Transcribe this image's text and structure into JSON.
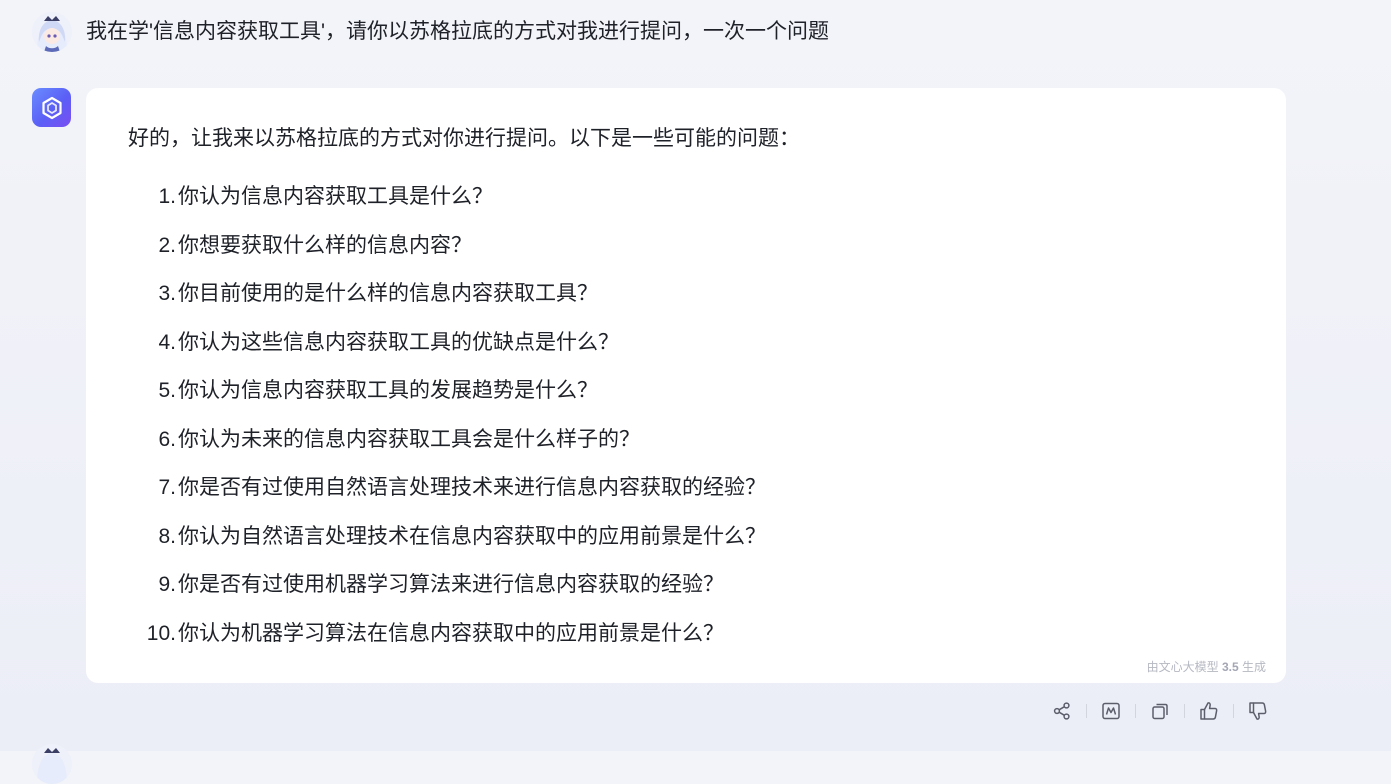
{
  "user_message": {
    "text": "我在学'信息内容获取工具'，请你以苏格拉底的方式对我进行提问，一次一个问题",
    "avatar_icon": "anime-girl-avatar"
  },
  "bot_message": {
    "avatar_icon": "ernie-bot-logo-icon",
    "intro": "好的，让我来以苏格拉底的方式对你进行提问。以下是一些可能的问题：",
    "questions": [
      {
        "num": "1.",
        "text": "你认为信息内容获取工具是什么？"
      },
      {
        "num": "2.",
        "text": "你想要获取什么样的信息内容？"
      },
      {
        "num": "3.",
        "text": "你目前使用的是什么样的信息内容获取工具？"
      },
      {
        "num": "4.",
        "text": "你认为这些信息内容获取工具的优缺点是什么？"
      },
      {
        "num": "5.",
        "text": "你认为信息内容获取工具的发展趋势是什么？"
      },
      {
        "num": "6.",
        "text": "你认为未来的信息内容获取工具会是什么样子的？"
      },
      {
        "num": "7.",
        "text": "你是否有过使用自然语言处理技术来进行信息内容获取的经验？"
      },
      {
        "num": "8.",
        "text": "你认为自然语言处理技术在信息内容获取中的应用前景是什么？"
      },
      {
        "num": "9.",
        "text": "你是否有过使用机器学习算法来进行信息内容获取的经验？"
      },
      {
        "num": "10.",
        "text": "你认为机器学习算法在信息内容获取中的应用前景是什么？"
      }
    ],
    "generated_by_prefix": "由文心大模型",
    "generated_by_version": "3.5",
    "generated_by_suffix": "生成"
  },
  "actions": [
    {
      "name": "share-icon"
    },
    {
      "name": "summary-icon"
    },
    {
      "name": "copy-icon"
    },
    {
      "name": "thumbs-up-icon"
    },
    {
      "name": "thumbs-down-icon"
    }
  ],
  "colors": {
    "background": "#f3f4f9",
    "card": "#ffffff",
    "text": "#1f2129",
    "muted": "#b6b8c2",
    "icon": "#5c5f6b",
    "brand": "#5b5ff6"
  }
}
